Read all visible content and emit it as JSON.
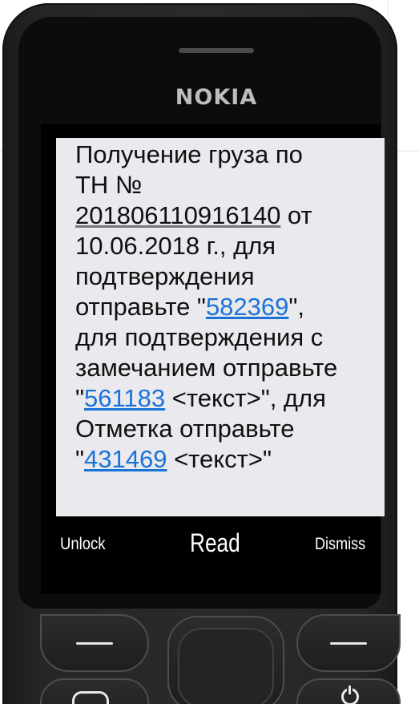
{
  "phone": {
    "brand": "NOKIA"
  },
  "message": {
    "line_1": "Получение груза по",
    "line_2": "ТН №",
    "doc_number": "201806110916140",
    "doc_suffix": " от",
    "line_4": "10.06.2018 г., для",
    "line_5": "подтверждения",
    "confirm_prefix": "отправьте \"",
    "confirm_code": "582369",
    "confirm_suffix": "\",",
    "line_7": "для подтверждения с",
    "line_8": "замечанием отправьте",
    "remark_prefix": "\"",
    "remark_code": "561183",
    "remark_suffix": " <текст>\", для",
    "line_10": "Отметка отправьте",
    "mark_prefix": "\"",
    "mark_code": "431469",
    "mark_suffix": " <текст>\""
  },
  "softkeys": {
    "left": "Unlock",
    "middle": "Read",
    "right": "Dismiss"
  },
  "colors": {
    "link": "#1a73d9",
    "message_background": "#e9e9ee",
    "screen": "#000000",
    "body": "#262626"
  }
}
